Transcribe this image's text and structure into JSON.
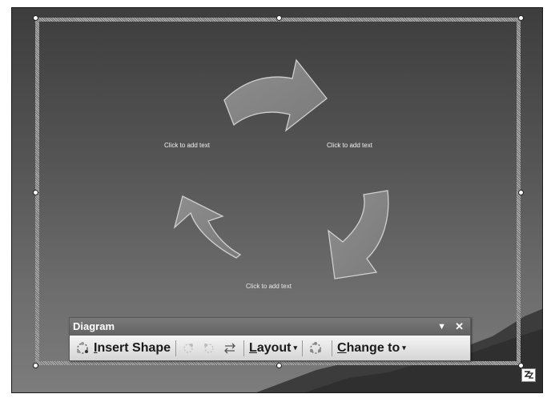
{
  "slide": {
    "placeholders": [
      {
        "id": "top-left",
        "text": "Click to add text"
      },
      {
        "id": "top-right",
        "text": "Click to add text"
      },
      {
        "id": "bottom",
        "text": "Click to add text"
      }
    ]
  },
  "toolbar": {
    "title": "Diagram",
    "menu_glyph": "▼",
    "close_glyph": "✕",
    "insert_shape": {
      "mnemonic": "I",
      "rest": "nsert Shape"
    },
    "layout": {
      "mnemonic": "L",
      "rest": "ayout",
      "dropdown": "▾"
    },
    "change_to": {
      "mnemonic": "C",
      "rest": "hange to",
      "dropdown": "▾"
    },
    "icons": [
      "insert-shape-icon",
      "move-backward-icon",
      "move-forward-icon",
      "reverse-diagram-icon",
      "autoformat-icon",
      "layout-icon"
    ]
  },
  "colors": {
    "slide_top": "#3d3d3d",
    "slide_bottom": "#7c7c7c",
    "arrow_fill": "#8a8a8a",
    "arrow_stroke": "#d0d0d0",
    "toolbar_title": "#6b6b6b",
    "toolbar_body": "#e4e4e4"
  }
}
